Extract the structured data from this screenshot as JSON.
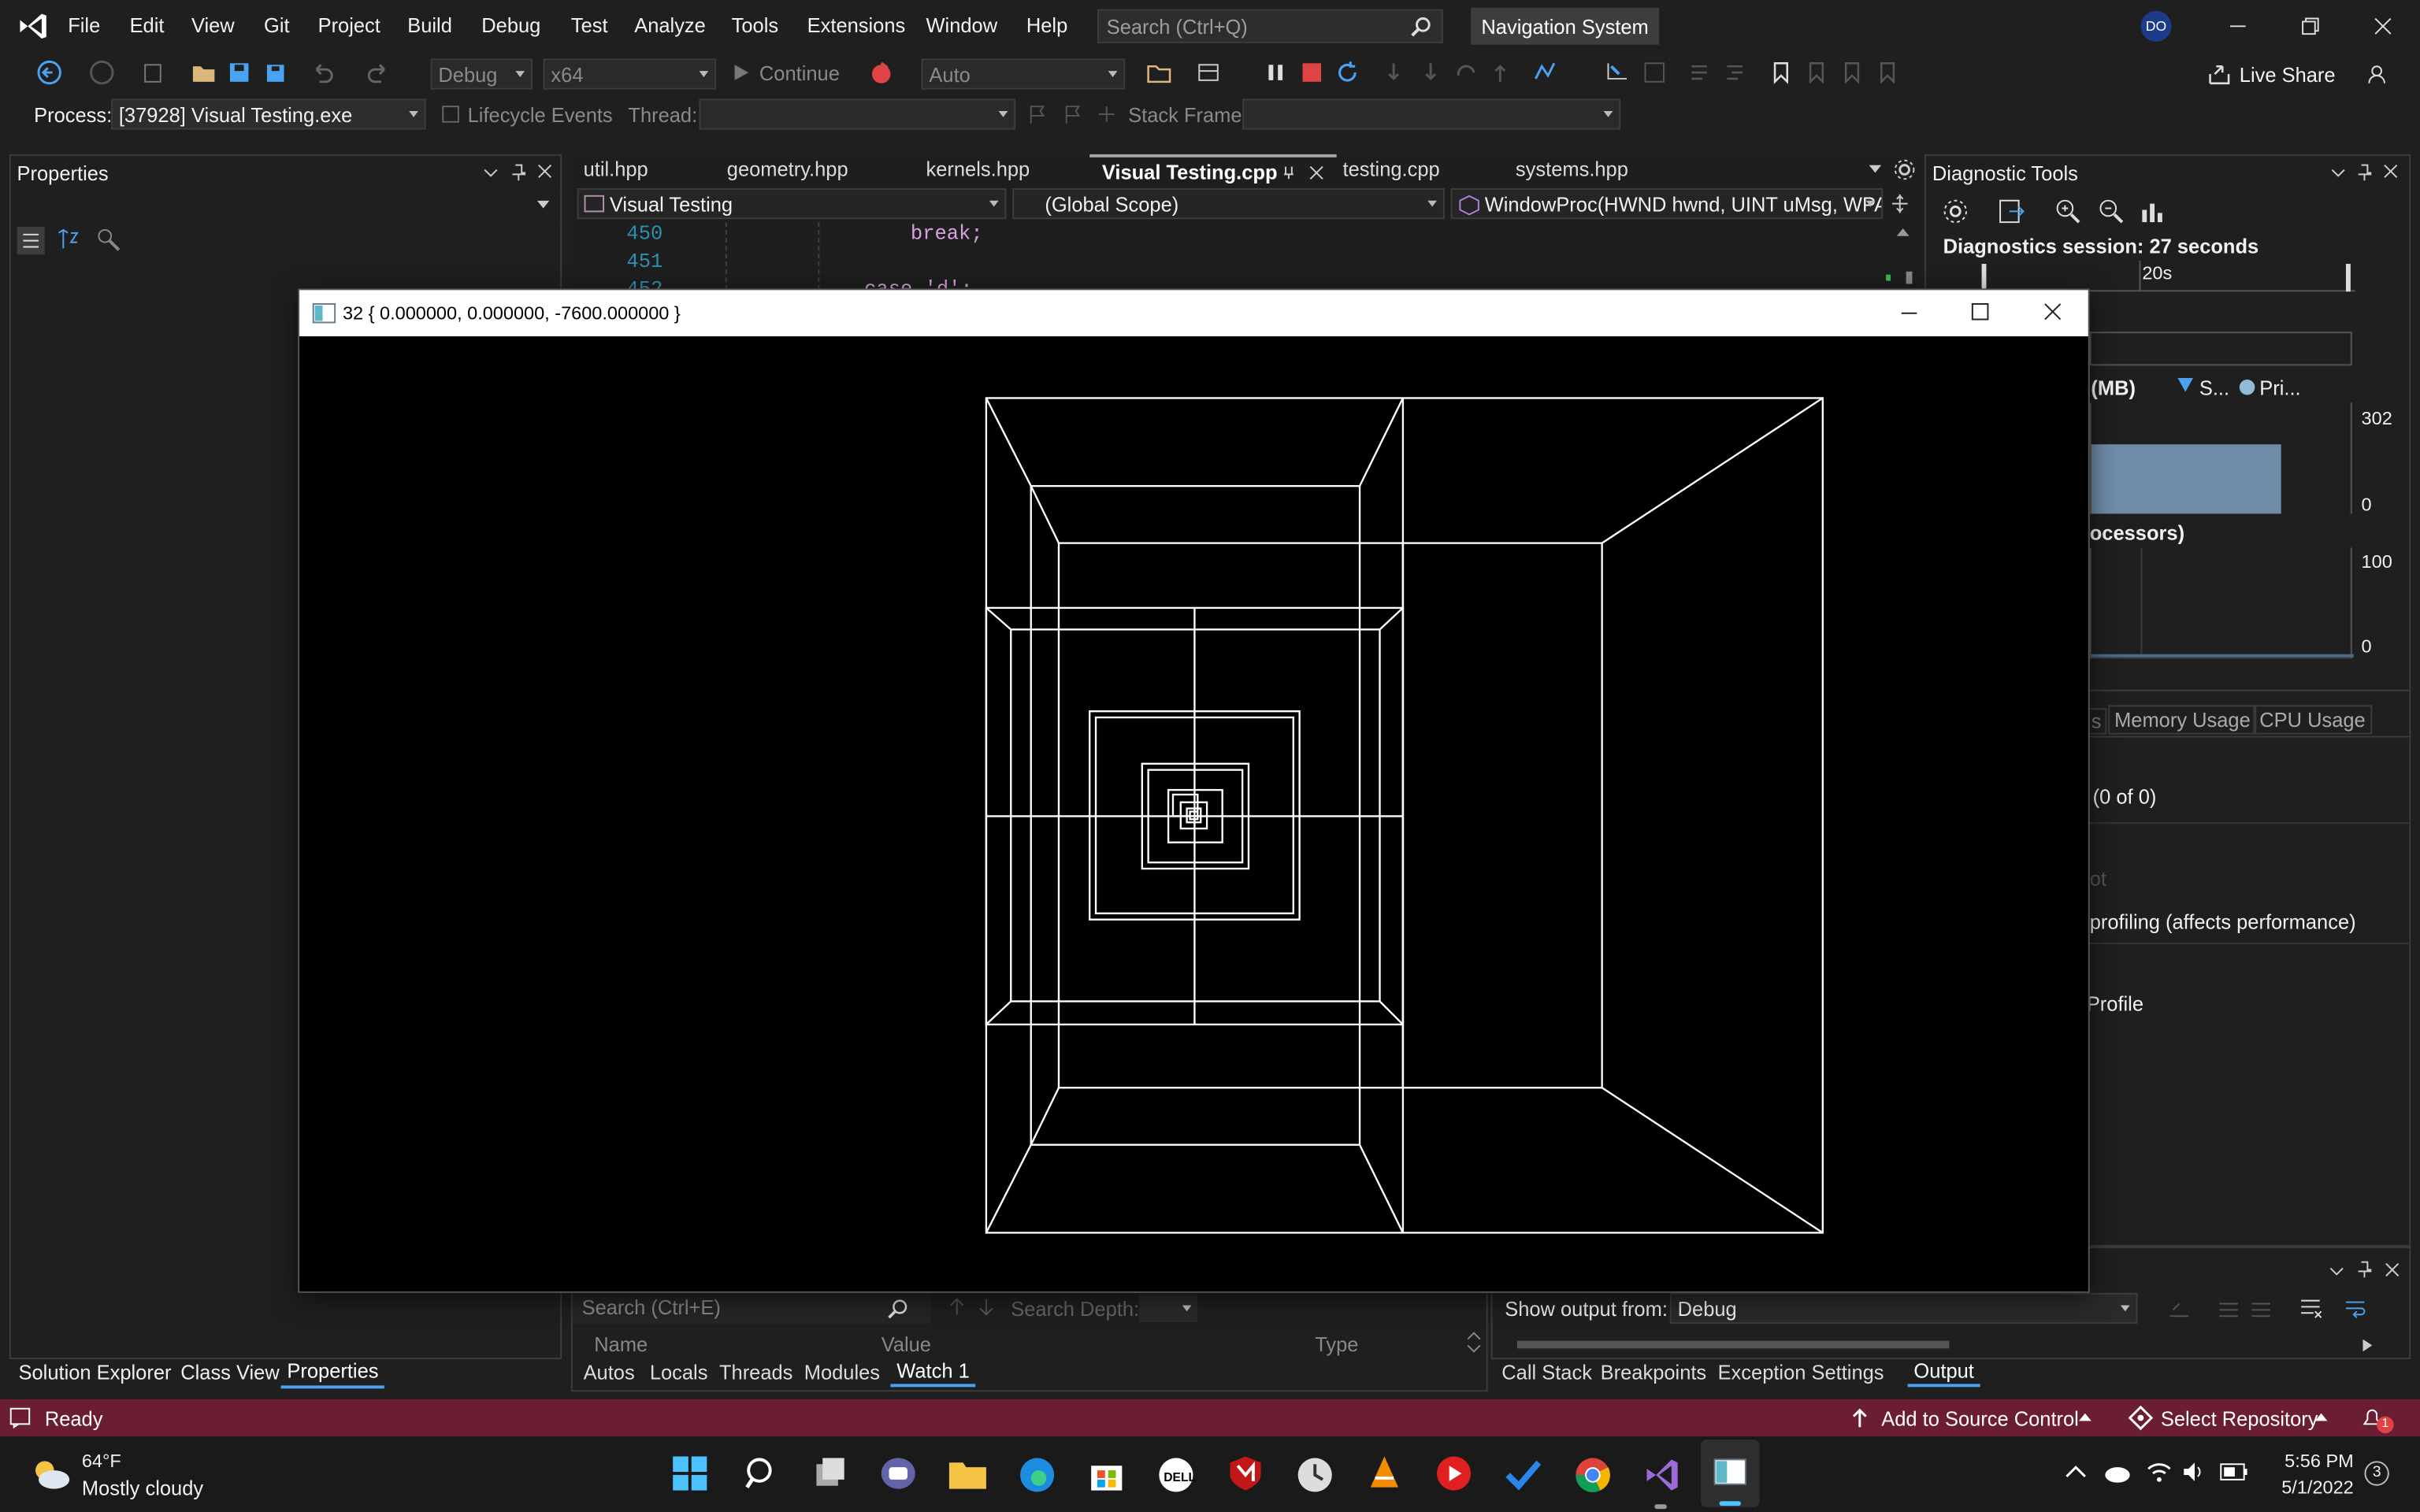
{
  "menu": {
    "items": [
      "File",
      "Edit",
      "View",
      "Git",
      "Project",
      "Build",
      "Debug",
      "Test",
      "Analyze",
      "Tools",
      "Extensions",
      "Window",
      "Help"
    ],
    "search_placeholder": "Search (Ctrl+Q)",
    "solution_name": "Navigation System",
    "user_initials": "DO"
  },
  "toolbar": {
    "config": "Debug",
    "platform": "x64",
    "continue_label": "Continue",
    "auto_label": "Auto",
    "live_share": "Live Share"
  },
  "toolbar2": {
    "process_label": "Process:",
    "process_value": "[37928] Visual Testing.exe",
    "lifecycle_label": "Lifecycle Events",
    "thread_label": "Thread:",
    "stack_label": "Stack Frame:"
  },
  "properties": {
    "title": "Properties"
  },
  "editor": {
    "tabs": [
      "util.hpp",
      "geometry.hpp",
      "kernels.hpp",
      "Visual Testing.cpp",
      "testing.cpp",
      "systems.hpp"
    ],
    "active_tab": "Visual Testing.cpp",
    "project_combo": "Visual Testing",
    "scope_combo": "(Global Scope)",
    "member_combo": "WindowProc(HWND hwnd, UINT uMsg, WPAI",
    "lines": [
      {
        "num": "450",
        "code": "break;"
      },
      {
        "num": "451",
        "code": ""
      },
      {
        "num": "452",
        "code": "case 'd':"
      }
    ]
  },
  "diagnostics": {
    "title": "Diagnostic Tools",
    "session": "Diagnostics session: 27 seconds",
    "timeline_label": "20s",
    "memory_label": "y (MB)",
    "legend1": "S...",
    "legend2": "Pri...",
    "mem_max": "302",
    "mem_min": "0",
    "cpu_label": "ocessors)",
    "cpu_max": "100",
    "cpu_min": "0",
    "tab_partial": "s",
    "tab_memory": "Memory Usage",
    "tab_cpu": "CPU Usage",
    "count": "(0 of 0)",
    "partial_ot": "ot",
    "profiling": "profiling (affects performance)",
    "profile": "Profile",
    "memory_fill": 0.62
  },
  "app_window": {
    "title": "32 { 0.000000, 0.000000, -7600.000000 }"
  },
  "watch": {
    "search_placeholder": "Search (Ctrl+E)",
    "search_depth": "Search Depth:",
    "col_name": "Name",
    "col_value": "Value",
    "col_type": "Type",
    "tabs": [
      "Autos",
      "Locals",
      "Threads",
      "Modules",
      "Watch 1"
    ]
  },
  "output": {
    "show_from": "Show output from:",
    "source": "Debug",
    "tabs": [
      "Call Stack",
      "Breakpoints",
      "Exception Settings",
      "Output"
    ]
  },
  "left_tabs": [
    "Solution Explorer",
    "Class View",
    "Properties"
  ],
  "status": {
    "ready": "Ready",
    "source_control": "Add to Source Control",
    "repo": "Select Repository",
    "notifications": "1"
  },
  "taskbar": {
    "temp": "64°F",
    "weather": "Mostly cloudy",
    "time": "5:56 PM",
    "date": "5/1/2022",
    "badge": "3"
  }
}
